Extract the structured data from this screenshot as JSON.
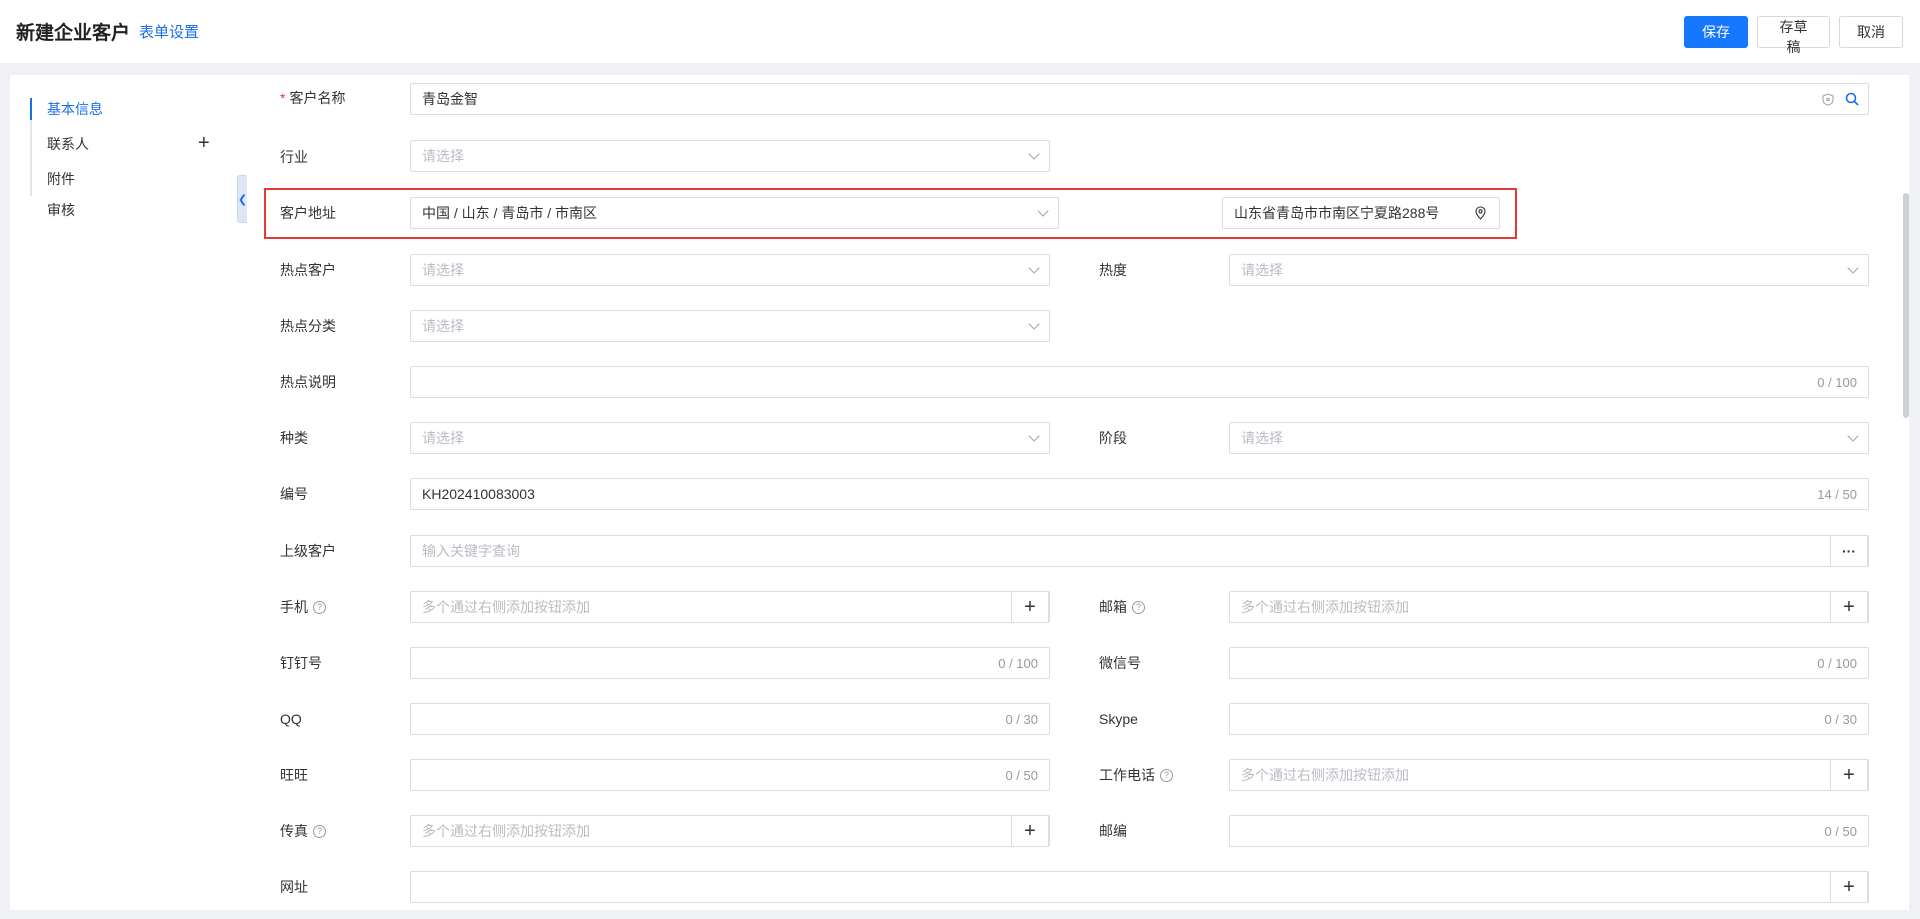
{
  "header": {
    "title": "新建企业客户",
    "form_settings": "表单设置",
    "save": "保存",
    "draft": "存草稿",
    "cancel": "取消"
  },
  "sidebar": {
    "items": [
      {
        "label": "基本信息",
        "active": true
      },
      {
        "label": "联系人"
      },
      {
        "label": "附件"
      },
      {
        "label": "审核"
      }
    ],
    "add_icon": "plus-icon",
    "collapse_icon": "chevron-left-icon"
  },
  "form": {
    "customer_name": {
      "label": "客户名称",
      "required": "*",
      "value": "青岛金智"
    },
    "industry": {
      "label": "行业",
      "placeholder": "请选择"
    },
    "address": {
      "label": "客户地址",
      "region": "中国 / 山东 / 青岛市 / 市南区",
      "detail": "山东省青岛市市南区宁夏路288号"
    },
    "hot_customer": {
      "label": "热点客户",
      "placeholder": "请选择"
    },
    "heat": {
      "label": "热度",
      "placeholder": "请选择"
    },
    "hot_category": {
      "label": "热点分类",
      "placeholder": "请选择"
    },
    "hot_desc": {
      "label": "热点说明",
      "counter": "0 / 100"
    },
    "kind": {
      "label": "种类",
      "placeholder": "请选择"
    },
    "stage": {
      "label": "阶段",
      "placeholder": "请选择"
    },
    "code": {
      "label": "编号",
      "value": "KH202410083003",
      "counter": "14 / 50"
    },
    "parent": {
      "label": "上级客户",
      "placeholder": "输入关键字查询",
      "more": "···"
    },
    "mobile": {
      "label": "手机",
      "placeholder": "多个通过右侧添加按钮添加"
    },
    "email": {
      "label": "邮箱",
      "placeholder": "多个通过右侧添加按钮添加"
    },
    "dingtalk": {
      "label": "钉钉号",
      "counter": "0 / 100"
    },
    "wechat": {
      "label": "微信号",
      "counter": "0 / 100"
    },
    "qq": {
      "label": "QQ",
      "counter": "0 / 30"
    },
    "skype": {
      "label": "Skype",
      "counter": "0 / 30"
    },
    "wangwang": {
      "label": "旺旺",
      "counter": "0 / 50"
    },
    "work_phone": {
      "label": "工作电话",
      "placeholder": "多个通过右侧添加按钮添加"
    },
    "fax": {
      "label": "传真",
      "placeholder": "多个通过右侧添加按钮添加"
    },
    "zip": {
      "label": "邮编",
      "counter": "0 / 50"
    },
    "website": {
      "label": "网址"
    }
  },
  "help_glyph": "?",
  "add_glyph": "+",
  "colors": {
    "accent": "#1677ff",
    "highlight": "#e53935"
  }
}
